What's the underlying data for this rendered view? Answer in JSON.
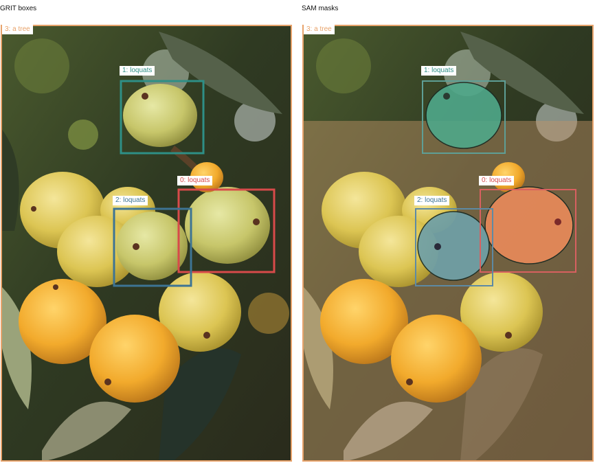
{
  "panels": {
    "left_title": "GRIT boxes",
    "right_title": "SAM masks"
  },
  "labels": {
    "tree": "3: a tree",
    "loquat0": "0: loquats",
    "loquat1": "1: loquats",
    "loquat2": "2: loquats"
  },
  "colors": {
    "tree": "#e8a36b",
    "loquat0": "#d84a4a",
    "loquat1": "#2e8f86",
    "loquat2": "#3d7494"
  }
}
